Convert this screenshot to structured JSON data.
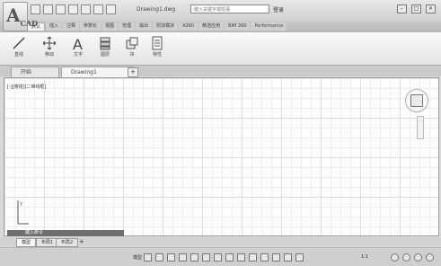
{
  "app": {
    "logo": "A",
    "logo_sub": "CAD",
    "document_title": "Drawing1.dwg",
    "search_placeholder": "键入关键字或短语",
    "signin_label": "登录"
  },
  "ribbon": {
    "tabs": [
      "默认",
      "插入",
      "注释",
      "参数化",
      "视图",
      "管理",
      "输出",
      "附加模块",
      "A360",
      "精选应用",
      "BIM 360",
      "Performance"
    ],
    "active_tab": "默认",
    "buttons": [
      {
        "label": "直线",
        "icon": "line-icon"
      },
      {
        "label": "移动",
        "icon": "move-icon"
      },
      {
        "label": "文字",
        "icon": "text-icon"
      },
      {
        "label": "图层",
        "icon": "layer-icon"
      },
      {
        "label": "块",
        "icon": "block-icon"
      },
      {
        "label": "特性",
        "icon": "properties-icon"
      }
    ]
  },
  "file_tabs": [
    {
      "label": "开始"
    },
    {
      "label": "Drawing1",
      "active": true
    }
  ],
  "canvas": {
    "view_label": "[-][俯视][二维线框]"
  },
  "command_line": {
    "placeholder": "键入命令"
  },
  "layout_tabs": [
    "模型",
    "布局1",
    "布局2"
  ],
  "status": {
    "mode": "模型",
    "scale": "1:1"
  }
}
